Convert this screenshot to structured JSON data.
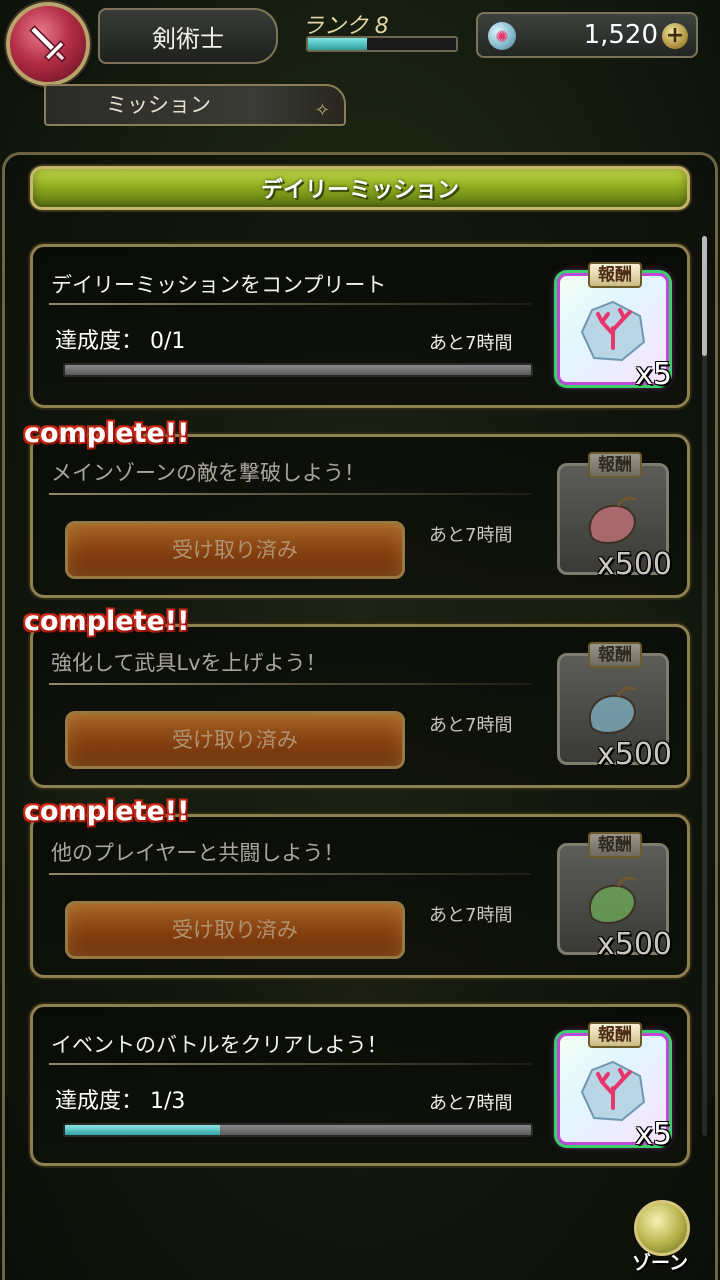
{
  "header": {
    "job_name": "剣術士",
    "rank_label": "ランク",
    "rank_value": "8",
    "rank_progress": 0.4,
    "gem_count": "1,520",
    "plus_symbol": "+"
  },
  "mission_tab": {
    "label": "ミッション"
  },
  "daily_header": {
    "title": "デイリーミッション"
  },
  "missions": [
    {
      "title": "デイリーミッションをコンプリート",
      "progress_label": "達成度：",
      "progress_value": "0/1",
      "progress_fraction": 0.0,
      "time_left": "あと7時間",
      "reward_tag": "報酬",
      "reward_icon": "coral-gem-icon",
      "reward_qty": "x5",
      "complete": false
    },
    {
      "complete_tag": "complete!!",
      "title": "メインゾーンの敵を撃破しよう！",
      "button_label": "受け取り済み",
      "time_left": "あと7時間",
      "reward_tag": "報酬",
      "reward_icon": "red-pouch-icon",
      "reward_qty": "x500",
      "complete": true
    },
    {
      "complete_tag": "complete!!",
      "title": "強化して武具Lvを上げよう！",
      "button_label": "受け取り済み",
      "time_left": "あと7時間",
      "reward_tag": "報酬",
      "reward_icon": "blue-pouch-icon",
      "reward_qty": "x500",
      "complete": true
    },
    {
      "complete_tag": "complete!!",
      "title": "他のプレイヤーと共闘しよう！",
      "button_label": "受け取り済み",
      "time_left": "あと7時間",
      "reward_tag": "報酬",
      "reward_icon": "green-pouch-icon",
      "reward_qty": "x500",
      "complete": true
    },
    {
      "title": "イベントのバトルをクリアしよう！",
      "progress_label": "達成度：",
      "progress_value": "1/3",
      "progress_fraction": 0.333,
      "time_left": "あと7時間",
      "reward_tag": "報酬",
      "reward_icon": "coral-gem-icon",
      "reward_qty": "x5",
      "complete": false
    }
  ],
  "zone_button": {
    "label": "ゾーン"
  },
  "colors": {
    "accent_green": "#8ca81d",
    "progress_cyan": "#2fa3a3",
    "complete_red": "#c21f12",
    "claimed_orange": "#a44c12",
    "rare_border": "#c04ad8"
  }
}
